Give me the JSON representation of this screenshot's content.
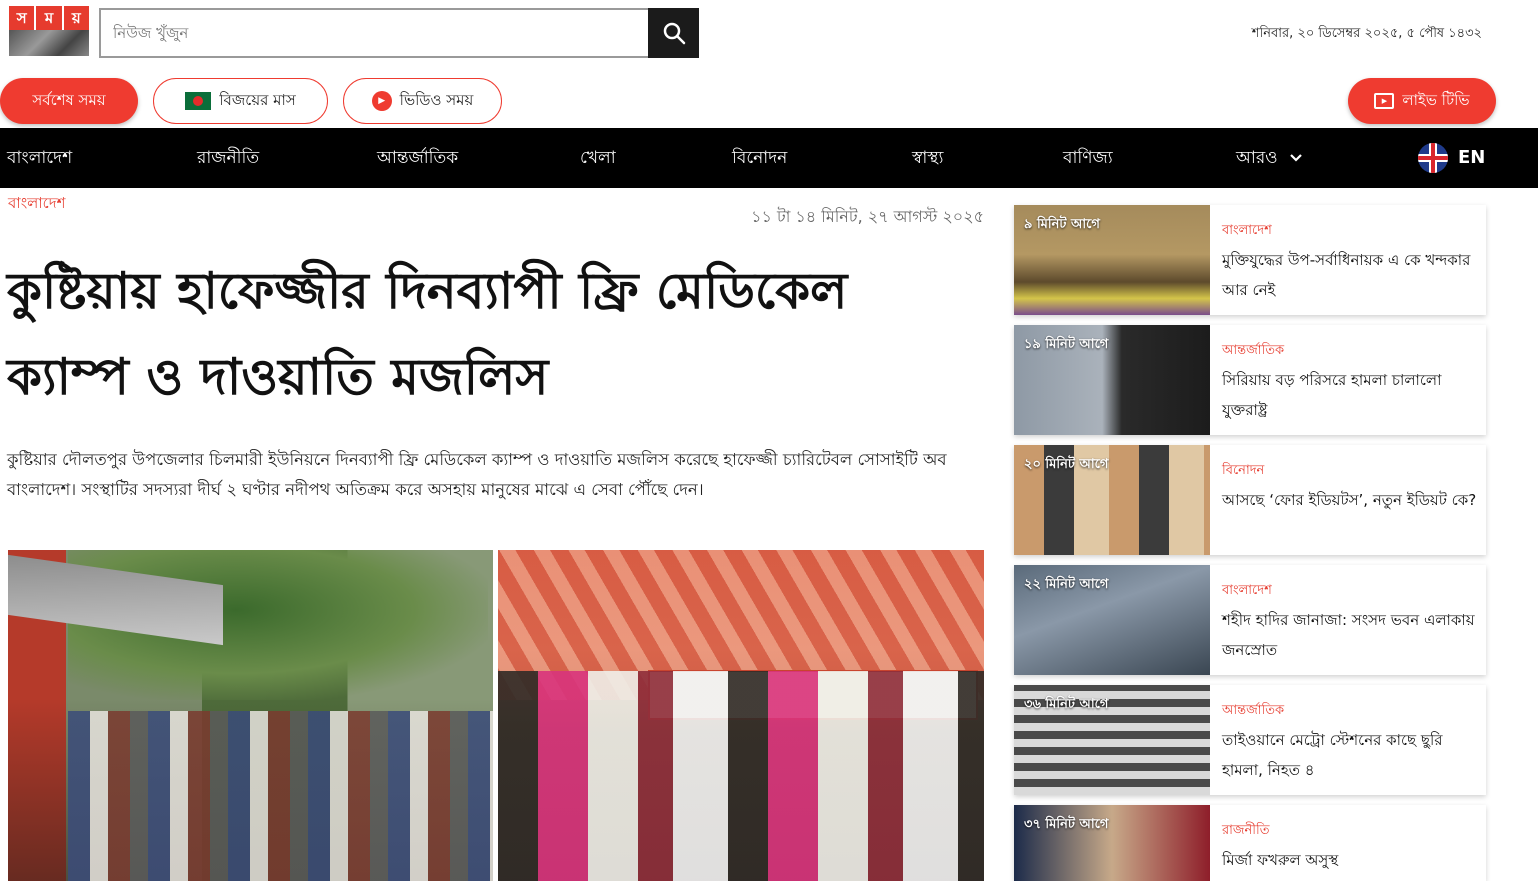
{
  "header": {
    "logo_letters": [
      "স",
      "ম",
      "য়"
    ],
    "search": {
      "placeholder": "নিউজ খুঁজুন"
    },
    "date": "শনিবার, ২০ ডিসেম্বর ২০২৫, ৫ পৌষ ১৪৩২"
  },
  "quick_links": {
    "latest": "সর্বশেষ সময়",
    "victory_month": "বিজয়ের মাস",
    "video": "ভিডিও সময়",
    "live_tv": "লাইভ টিভি"
  },
  "nav": {
    "items": [
      "বাংলাদেশ",
      "রাজনীতি",
      "আন্তর্জাতিক",
      "খেলা",
      "বিনোদন",
      "স্বাস্থ্য",
      "বাণিজ্য",
      "আরও"
    ],
    "language": "EN"
  },
  "article": {
    "category": "বাংলাদেশ",
    "published": "১১ টা ১৪ মিনিট, ২৭ আগস্ট ২০২৫",
    "headline": "কুষ্টিয়ায় হাফেজ্জীর দিনব্যাপী ফ্রি মেডিকেল ক্যাম্প ও দাওয়াতি মজলিস",
    "lead": "কুষ্টিয়ার দৌলতপুর উপজেলার চিলমারী ইউনিয়নে দিনব্যাপী ফ্রি মেডিকেল ক্যাম্প ও দাওয়াতি মজলিস করেছে হাফেজ্জী চ্যারিটেবল সোসাইটি অব বাংলাদেশ। সংস্থাটির সদস্যরা দীর্ঘ ২ ঘণ্টার নদীপথ অতিক্রম করে অসহায় মানুষের মাঝে এ সেবা পৌঁছে দেন।"
  },
  "sidebar": {
    "items": [
      {
        "time": "৯ মিনিট আগে",
        "category": "বাংলাদেশ",
        "title": "মুক্তিযুদ্ধের উপ-সর্বাধিনায়ক এ কে খন্দকার আর নেই"
      },
      {
        "time": "১৯ মিনিট আগে",
        "category": "আন্তর্জাতিক",
        "title": "সিরিয়ায় বড় পরিসরে হামলা চালালো যুক্তরাষ্ট্র"
      },
      {
        "time": "২০ মিনিট আগে",
        "category": "বিনোদন",
        "title": "আসছে ‘ফোর ইডিয়টস’, নতুন ইডিয়ট কে?"
      },
      {
        "time": "২২ মিনিট আগে",
        "category": "বাংলাদেশ",
        "title": "শহীদ হাদির জানাজা: সংসদ ভবন এলাকায় জনস্রোত"
      },
      {
        "time": "৩৬ মিনিট আগে",
        "category": "আন্তর্জাতিক",
        "title": "তাইওয়ানে মেট্রো স্টেশনের কাছে ছুরি হামলা, নিহত ৪"
      },
      {
        "time": "৩৭ মিনিট আগে",
        "category": "রাজনীতি",
        "title": "মির্জা ফখরুল অসুস্থ"
      }
    ]
  },
  "colors": {
    "brand_red": "#e63b2e",
    "nav_bg": "#000000"
  },
  "icons": [
    "search-icon",
    "flag-icon",
    "play-icon",
    "tv-icon",
    "chevron-down-icon",
    "uk-flag-icon"
  ]
}
